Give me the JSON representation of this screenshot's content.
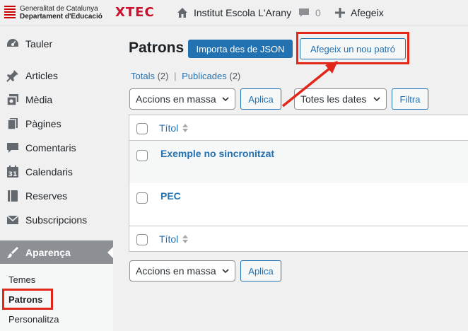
{
  "topbar": {
    "gencat_line1": "Generalitat de Catalunya",
    "gencat_line2": "Departament d'Educació",
    "xtec_logo": "XTEC",
    "site_name": "Institut Escola L'Arany",
    "comments_count": "0",
    "add_new_label": "Afegeix"
  },
  "sidebar": {
    "items": [
      {
        "label": "Tauler",
        "icon": "dashboard-icon"
      },
      {
        "label": "Articles",
        "icon": "pin-icon"
      },
      {
        "label": "Mèdia",
        "icon": "media-icon"
      },
      {
        "label": "Pàgines",
        "icon": "pages-icon"
      },
      {
        "label": "Comentaris",
        "icon": "comment-icon"
      },
      {
        "label": "Calendaris",
        "icon": "calendar-icon"
      },
      {
        "label": "Reserves",
        "icon": "book-icon"
      },
      {
        "label": "Subscripcions",
        "icon": "mail-icon"
      },
      {
        "label": "Aparença",
        "icon": "brush-icon"
      }
    ],
    "calendar_day": "31",
    "submenu": [
      "Temes",
      "Patrons",
      "Personalitza"
    ]
  },
  "main": {
    "title": "Patrons",
    "import_button": "Importa des de JSON",
    "add_button": "Afegeix un nou patró",
    "views": {
      "all_label": "Totals",
      "all_count": "(2)",
      "separator": "|",
      "published_label": "Publicades",
      "published_count": "(2)"
    },
    "bulk_actions": "Accions en massa",
    "apply": "Aplica",
    "all_dates": "Totes les dates",
    "filter": "Filtra",
    "table": {
      "column_title": "Títol",
      "rows": [
        "Exemple no sincronitzat",
        "PEC"
      ]
    }
  },
  "colors": {
    "primary": "#2271b1",
    "highlight": "#e3261a",
    "active_menu": "#8c8f94"
  }
}
